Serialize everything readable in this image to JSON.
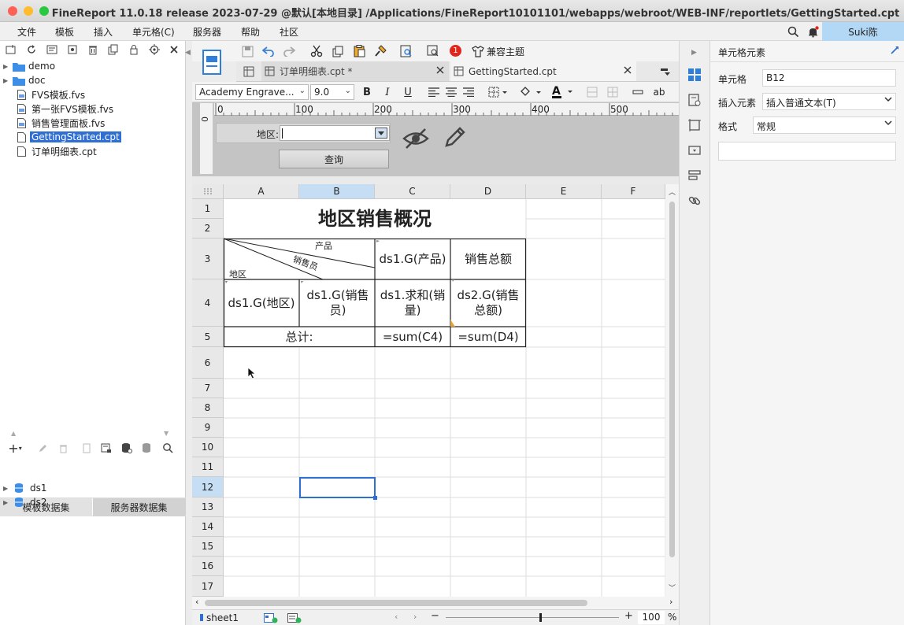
{
  "window": {
    "title": "FineReport 11.0.18 release 2023-07-29 @默认[本地目录]   /Applications/FineReport10101101/webapps/webroot/WEB-INF/reportlets/GettingStarted.cpt",
    "traffic_colors": [
      "#fe5f57",
      "#febc2e",
      "#28c840"
    ]
  },
  "menu": {
    "items": [
      "文件",
      "模板",
      "插入",
      "单元格(C)",
      "服务器",
      "帮助",
      "社区"
    ],
    "user": "Suki陈",
    "notification_color": "#e0261c"
  },
  "toolbar": {
    "badge_count": "1",
    "compat_theme_label": "兼容主题"
  },
  "file_tree": {
    "items": [
      {
        "label": "demo",
        "icon": "folder-icon"
      },
      {
        "label": "doc",
        "icon": "folder-icon"
      },
      {
        "label": "FVS模板.fvs",
        "icon": "fvs-file-icon"
      },
      {
        "label": "第一张FVS模板.fvs",
        "icon": "fvs-file-icon"
      },
      {
        "label": "销售管理面板.fvs",
        "icon": "fvs-file-icon"
      },
      {
        "label": "GettingStarted.cpt",
        "icon": "cpt-file-icon",
        "selected": true
      },
      {
        "label": "订单明细表.cpt",
        "icon": "cpt-file-icon"
      }
    ]
  },
  "datasets": {
    "tabs": [
      "模板数据集",
      "服务器数据集"
    ],
    "items": [
      "ds1",
      "ds2"
    ]
  },
  "tabs": [
    {
      "label": "订单明细表.cpt *",
      "active": false
    },
    {
      "label": "GettingStarted.cpt",
      "active": true
    }
  ],
  "format": {
    "font": "Academy Engrave...",
    "size": "9.0",
    "font_color": "#111111"
  },
  "param_pane": {
    "ruler_ticks": [
      "0",
      "100",
      "200",
      "300",
      "400",
      "500"
    ],
    "vruler_tick": "0",
    "region_label": "地区:",
    "query_button": "查询"
  },
  "sheet": {
    "columns": [
      "A",
      "B",
      "C",
      "D",
      "E",
      "F"
    ],
    "rows": [
      "1",
      "2",
      "3",
      "4",
      "5",
      "6",
      "7",
      "8",
      "9",
      "10",
      "11",
      "12",
      "13",
      "14",
      "15",
      "16",
      "17"
    ],
    "cells": {
      "title": "地区销售概况",
      "slash_product": "产品",
      "slash_salesperson": "销售员",
      "slash_region": "地区",
      "c3": "ds1.G(产品)",
      "d3": "销售总额",
      "a4": "ds1.G(地区)",
      "b4": "ds1.G(销售员)",
      "c4": "ds1.求和(销量)",
      "d4": "ds2.G(销售总额)",
      "a5": "总计:",
      "c5": "=sum(C4)",
      "d5": "=sum(D4)"
    },
    "selected_cell": "B12"
  },
  "status": {
    "sheet_tab": "sheet1",
    "zoom": "100",
    "zoom_unit": "%"
  },
  "cell_panel": {
    "title": "单元格元素",
    "cell_label": "单元格",
    "cell_value": "B12",
    "insert_label": "插入元素",
    "insert_value": "插入普通文本(T)",
    "format_label": "格式",
    "format_value": "常规",
    "accent": "#2f6fd3"
  }
}
